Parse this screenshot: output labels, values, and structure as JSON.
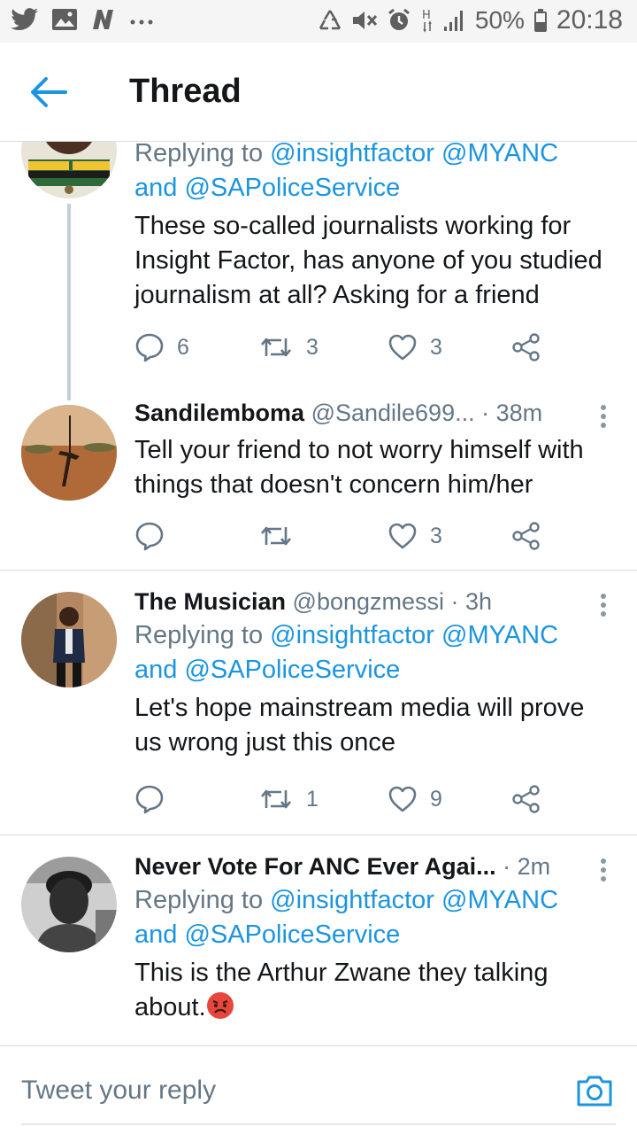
{
  "status_bar": {
    "battery_percent": "50%",
    "time": "20:18",
    "left_icons": [
      "twitter-icon",
      "gallery-icon",
      "n-app-icon",
      "more-dots-icon"
    ],
    "right_icons": [
      "recycle-icon",
      "mute-icon",
      "alarm-icon",
      "h-signal-icon",
      "signal-icon",
      "battery-icon"
    ]
  },
  "header": {
    "title": "Thread"
  },
  "tweets": [
    {
      "reply_prefix": "Replying to",
      "mention1": "@insightfactor",
      "mention2": "@MYANC",
      "and": "and",
      "mention3": "@SAPoliceService",
      "text": "These so-called journalists working for Insight Factor, has anyone of you studied journalism at all? Asking for a friend",
      "replies": "6",
      "retweets": "3",
      "likes": "3"
    },
    {
      "name": "Sandilemboma",
      "handle": "@Sandile699...",
      "time": "· 38m",
      "text": "Tell your friend to not worry himself with things that doesn't concern him/her",
      "replies": "",
      "retweets": "",
      "likes": "3"
    },
    {
      "name": "The Musician",
      "handle": "@bongzmessi",
      "time": "· 3h",
      "reply_prefix": "Replying to",
      "mention1": "@insightfactor",
      "mention2": "@MYANC",
      "and": "and",
      "mention3": "@SAPoliceService",
      "text": "Let's hope mainstream media will prove us wrong just this once",
      "replies": "",
      "retweets": "1",
      "likes": "9"
    },
    {
      "name": "Never Vote For ANC Ever Agai...",
      "handle": "",
      "time": "· 2m",
      "reply_prefix": "Replying to",
      "mention1": "@insightfactor",
      "mention2": "@MYANC",
      "and": "and",
      "mention3": "@SAPoliceService",
      "text": "This is the Arthur Zwane they talking about.",
      "emoji": "angry-face-emoji"
    }
  ],
  "reply_bar": {
    "placeholder": "Tweet your reply"
  },
  "colors": {
    "accent": "#1b95e0",
    "text": "#14171a",
    "secondary": "#657786",
    "divider": "#d8dde2"
  }
}
